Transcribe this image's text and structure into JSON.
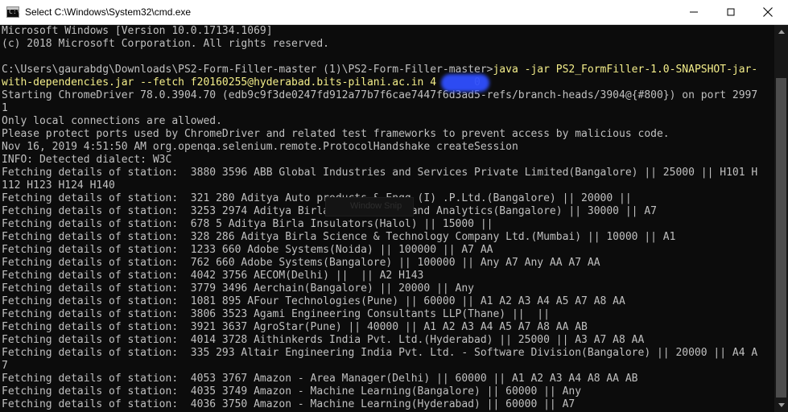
{
  "window": {
    "title": "Select C:\\Windows\\System32\\cmd.exe",
    "app_icon": "cmd-icon",
    "app_icon_prompt": "C:\\",
    "controls": [
      "minimize-icon",
      "maximize-icon",
      "close-icon"
    ]
  },
  "colors": {
    "console_bg": "#0c0c0c",
    "console_text": "#c0c0c0",
    "command_highlight": "#f4ee8a",
    "redaction": "#2f4fff",
    "titlebar_bg": "#ffffff"
  },
  "console": {
    "lines": [
      {
        "text": "Microsoft Windows [Version 10.0.17134.1069]"
      },
      {
        "text": "(c) 2018 Microsoft Corporation. All rights reserved."
      },
      {
        "text": ""
      },
      {
        "prompt": "C:\\Users\\gaurabdg\\Downloads\\PS2-Form-Filler-master (1)\\PS2-Form-Filler-master>",
        "command": "java -jar PS2_FormFiller-1.0-SNAPSHOT-jar-"
      },
      {
        "command": "with-dependencies.jar --fetch f20160255@hyderabad.bits-pilani.ac.in 4      0"
      },
      {
        "text": "Starting ChromeDriver 78.0.3904.70 (edb9c9f3de0247fd912a77b7f6cae7447f6d3ad5-refs/branch-heads/3904@{#800}) on port 2997"
      },
      {
        "text": "1"
      },
      {
        "text": "Only local connections are allowed."
      },
      {
        "text": "Please protect ports used by ChromeDriver and related test frameworks to prevent access by malicious code."
      },
      {
        "text": "Nov 16, 2019 4:51:50 AM org.openqa.selenium.remote.ProtocolHandshake createSession"
      },
      {
        "text": "INFO: Detected dialect: W3C"
      },
      {
        "text": "Fetching details of station:  3880 3596 ABB Global Industries and Services Private Limited(Bangalore) || 25000 || H101 H"
      },
      {
        "text": "112 H123 H124 H140"
      },
      {
        "text": "Fetching details of station:  321 280 Aditya Auto products & Engg (I) .P.Ltd.(Bangalore) || 20000 ||"
      },
      {
        "text": "Fetching details of station:  3253 2974 Aditya Birla Group -Data and Analytics(Bangalore) || 30000 || A7"
      },
      {
        "text": "Fetching details of station:  678 5 Aditya Birla Insulators(Halol) || 15000 ||"
      },
      {
        "text": "Fetching details of station:  328 286 Aditya Birla Science & Technology Company Ltd.(Mumbai) || 10000 || A1"
      },
      {
        "text": "Fetching details of station:  1233 660 Adobe Systems(Noida) || 100000 || A7 AA"
      },
      {
        "text": "Fetching details of station:  762 660 Adobe Systems(Bangalore) || 100000 || Any A7 Any AA A7 AA"
      },
      {
        "text": "Fetching details of station:  4042 3756 AECOM(Delhi) ||  || A2 H143"
      },
      {
        "text": "Fetching details of station:  3779 3496 Aerchain(Bangalore) || 20000 || Any"
      },
      {
        "text": "Fetching details of station:  1081 895 AFour Technologies(Pune) || 60000 || A1 A2 A3 A4 A5 A7 A8 AA"
      },
      {
        "text": "Fetching details of station:  3806 3523 Agami Engineering Consultants LLP(Thane) ||  ||"
      },
      {
        "text": "Fetching details of station:  3921 3637 AgroStar(Pune) || 40000 || A1 A2 A3 A4 A5 A7 A8 AA AB"
      },
      {
        "text": "Fetching details of station:  4014 3728 Aithinkerds India Pvt. Ltd.(Hyderabad) || 25000 || A3 A7 A8 AA"
      },
      {
        "text": "Fetching details of station:  335 293 Altair Engineering India Pvt. Ltd. - Software Division(Bangalore) || 20000 || A4 A"
      },
      {
        "text": "7"
      },
      {
        "text": "Fetching details of station:  4053 3767 Amazon - Area Manager(Delhi) || 60000 || A1 A2 A3 A4 A8 AA AB"
      },
      {
        "text": "Fetching details of station:  4035 3749 Amazon - Machine Learning(Bangalore) || 60000 || Any"
      },
      {
        "text": "Fetching details of station:  4036 3750 Amazon - Machine Learning(Hyderabad) || 60000 || A7"
      }
    ]
  },
  "overlay": {
    "snip_label": "Window Snip"
  },
  "scrollbar": {
    "up_icon": "scroll-up-arrow-icon",
    "down_icon": "scroll-down-arrow-icon"
  }
}
